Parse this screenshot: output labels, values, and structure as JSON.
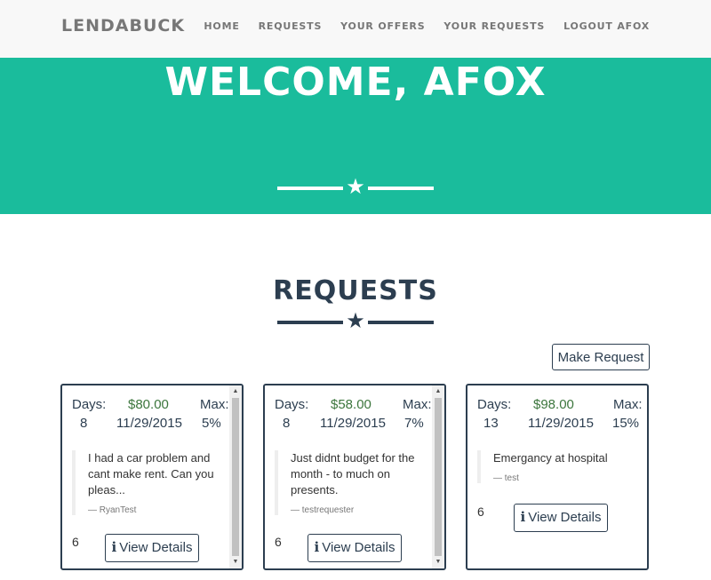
{
  "nav": {
    "brand": "LENDABUCK",
    "links": [
      "HOME",
      "REQUESTS",
      "YOUR OFFERS",
      "YOUR REQUESTS",
      "LOGOUT AFOX"
    ]
  },
  "hero": {
    "title": "WELCOME, AFOX",
    "icon": "star-icon"
  },
  "section": {
    "title": "REQUESTS",
    "make_request_label": "Make Request",
    "icon": "star-icon"
  },
  "labels": {
    "days": "Days:",
    "max": "Max:",
    "view_details": "View Details"
  },
  "cards": [
    {
      "days": "8",
      "amount": "$80.00",
      "date": "11/29/2015",
      "max": "5%",
      "text": "I had a car problem and cant make rent. Can you pleas...",
      "author": "— RyanTest",
      "count": "6",
      "scrollbar": true
    },
    {
      "days": "8",
      "amount": "$58.00",
      "date": "11/29/2015",
      "max": "7%",
      "text": "Just didnt budget for the month - to much on presents.",
      "author": "— testrequester",
      "count": "6",
      "scrollbar": true
    },
    {
      "days": "13",
      "amount": "$98.00",
      "date": "11/29/2015",
      "max": "15%",
      "text": "Emergancy at hospital",
      "author": "— test",
      "count": "6",
      "scrollbar": false
    }
  ],
  "colors": {
    "accent": "#1abc9c",
    "primary": "#2c3e50",
    "money": "#3c763d",
    "nav_bg": "#f8f8f8"
  }
}
